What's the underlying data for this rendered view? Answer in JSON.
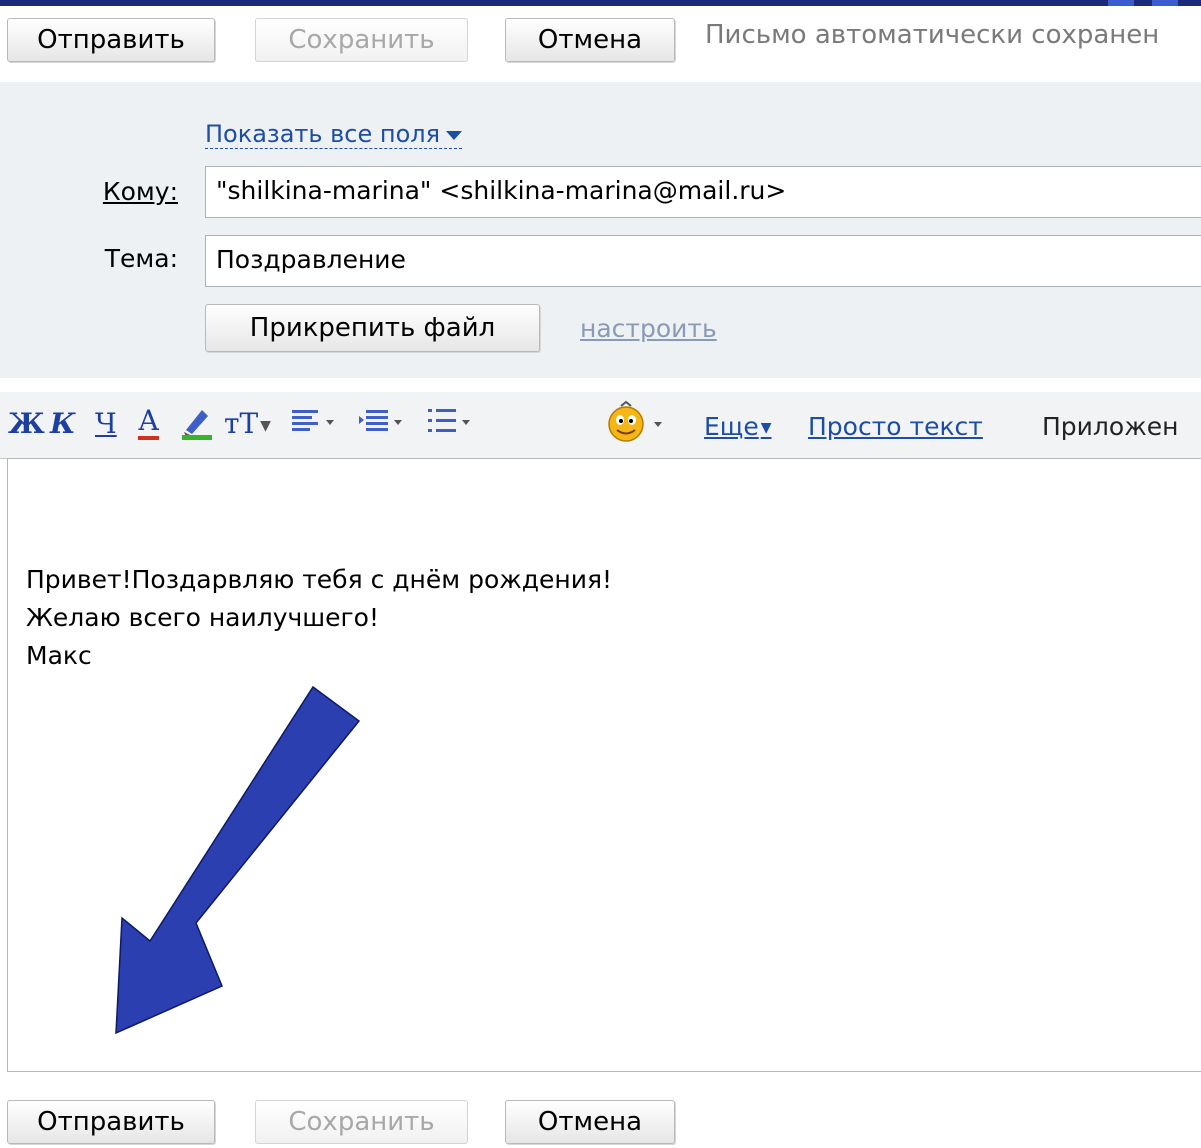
{
  "top_actions": {
    "send_label": "Отправить",
    "save_label": "Сохранить",
    "cancel_label": "Отмена",
    "autosave_status": "Письмо автоматически сохранен"
  },
  "compose": {
    "show_all_fields": "Показать все поля",
    "to_label": "Кому:",
    "to_value": "\"shilkina-marina\" <shilkina-marina@mail.ru>",
    "subject_label": "Тема:",
    "subject_value": "Поздравление",
    "attach_label": "Прикрепить файл",
    "configure_link": "настроить"
  },
  "toolbar": {
    "bold": "Ж",
    "italic": "К",
    "underline": "Ч",
    "font_color": "А",
    "font_size": "тТ",
    "more": "Еще",
    "plain_text": "Просто текст",
    "attachments": "Приложен"
  },
  "body": {
    "lines": [
      "Привет!Поздарвляю тебя с днём рождения!",
      "Желаю всего наилучшего!",
      "Макс"
    ]
  },
  "bottom_actions": {
    "send_label": "Отправить",
    "save_label": "Сохранить",
    "cancel_label": "Отмена"
  },
  "colors": {
    "arrow": "#2b3fb0",
    "link": "#1c4ea3",
    "panel": "#eef1f4"
  },
  "icons": [
    "highlighter-icon",
    "align-icon",
    "indent-icon",
    "list-icon",
    "smiley-icon",
    "arrow-annotation"
  ]
}
